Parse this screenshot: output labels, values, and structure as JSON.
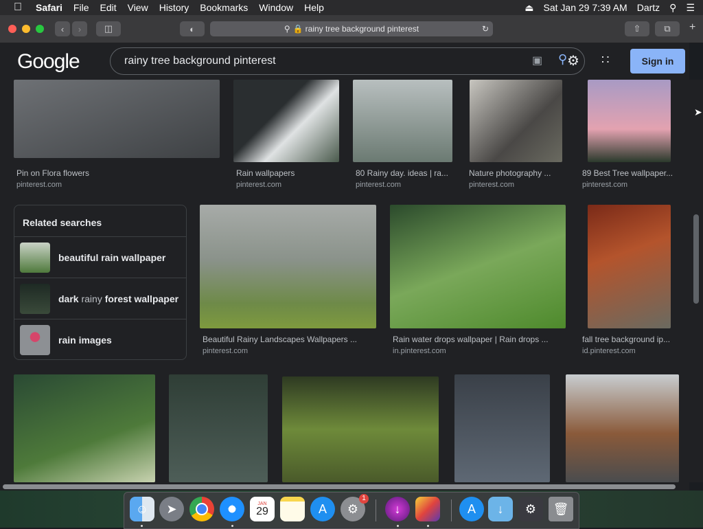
{
  "menubar": {
    "app": "Safari",
    "items": [
      "File",
      "Edit",
      "View",
      "History",
      "Bookmarks",
      "Window",
      "Help"
    ],
    "clock": "Sat Jan 29  7:39 AM",
    "user": "Dartz"
  },
  "browser": {
    "url": "rainy tree background pinterest"
  },
  "google": {
    "logo": "Google",
    "query": "rainy tree background pinterest",
    "sign_in": "Sign in"
  },
  "results": [
    {
      "caption": "Pin on Flora flowers",
      "source": "pinterest.com",
      "color": "#5a5d60"
    },
    {
      "caption": "Rain wallpapers",
      "source": "pinterest.com",
      "color": "#3f4a48"
    },
    {
      "caption": "80 Rainy day. ideas | ra...",
      "source": "pinterest.com",
      "color": "#7c8786"
    },
    {
      "caption": "Nature photography ...",
      "source": "pinterest.com",
      "color": "#6b6a66"
    },
    {
      "caption": "89 Best Tree wallpaper...",
      "source": "pinterest.com",
      "color": "#b48aa4"
    },
    {
      "caption": "Beautiful Rainy Landscapes Wallpapers ...",
      "source": "pinterest.com",
      "color": "#8a9188"
    },
    {
      "caption": "Rain water drops wallpaper | Rain drops ...",
      "source": "in.pinterest.com",
      "color": "#3d6b3a"
    },
    {
      "caption": "fall tree background ip...",
      "source": "id.pinterest.com",
      "color": "#8a3a22"
    },
    {
      "caption": "",
      "source": "",
      "color": "#2c4a32"
    },
    {
      "caption": "",
      "source": "",
      "color": "#3b4c4a"
    },
    {
      "caption": "",
      "source": "",
      "color": "#4a5a32"
    },
    {
      "caption": "",
      "source": "",
      "color": "#4b5058"
    },
    {
      "caption": "",
      "source": "",
      "color": "#6a6a68"
    }
  ],
  "related": {
    "title": "Related searches",
    "items": [
      {
        "bold1": "beautiful rain wallpaper",
        "normal": "",
        "bold2": "",
        "color": "#5b7a4c"
      },
      {
        "bold1": "dark",
        "normal": " rainy ",
        "bold2": "forest wallpaper",
        "color": "#2c3a34"
      },
      {
        "bold1": "rain images",
        "normal": "",
        "bold2": "",
        "color": "#8d9094"
      }
    ]
  },
  "dock": {
    "calendar_day": "29",
    "calendar_month": "JAN",
    "badge": "1"
  }
}
